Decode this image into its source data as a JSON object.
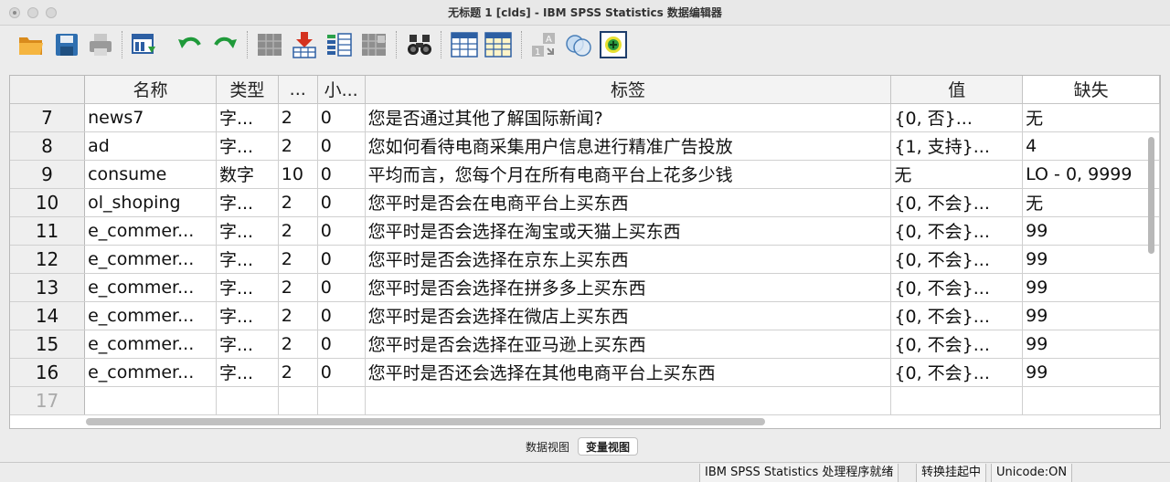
{
  "window": {
    "title": "无标题 1 [clds] - IBM SPSS Statistics 数据编辑器"
  },
  "toolbar": {
    "buttons": [
      {
        "icon": "open-folder-icon"
      },
      {
        "icon": "save-icon"
      },
      {
        "icon": "print-icon"
      },
      {
        "icon": "recall-dialog-icon"
      },
      {
        "icon": "undo-icon"
      },
      {
        "icon": "redo-icon"
      },
      {
        "icon": "goto-case-icon"
      },
      {
        "icon": "insert-case-icon"
      },
      {
        "icon": "insert-variable-icon"
      },
      {
        "icon": "split-file-icon"
      },
      {
        "icon": "find-icon"
      },
      {
        "icon": "data-view-grid-icon"
      },
      {
        "icon": "variable-view-grid-icon"
      },
      {
        "icon": "value-labels-icon"
      },
      {
        "icon": "use-sets-icon"
      },
      {
        "icon": "spelling-icon"
      }
    ]
  },
  "grid": {
    "columns": [
      "名称",
      "类型",
      "...",
      "小...",
      "标签",
      "值",
      "缺失"
    ],
    "rows": [
      {
        "n": "7",
        "name": "news7",
        "type": "字...",
        "width": "2",
        "dec": "0",
        "label": "您是否通过其他了解国际新闻?",
        "values": "{0, 否}...",
        "missing": "无"
      },
      {
        "n": "8",
        "name": "ad",
        "type": "字...",
        "width": "2",
        "dec": "0",
        "label": "您如何看待电商采集用户信息进行精准广告投放",
        "values": "{1, 支持}...",
        "missing": "4"
      },
      {
        "n": "9",
        "name": "consume",
        "type": "数字",
        "width": "10",
        "dec": "0",
        "label": "平均而言，您每个月在所有电商平台上花多少钱",
        "values": "无",
        "missing": "LO - 0, 9999"
      },
      {
        "n": "10",
        "name": "ol_shoping",
        "type": "字...",
        "width": "2",
        "dec": "0",
        "label": "您平时是否会在电商平台上买东西",
        "values": "{0, 不会}...",
        "missing": "无"
      },
      {
        "n": "11",
        "name": "e_commer...",
        "type": "字...",
        "width": "2",
        "dec": "0",
        "label": "您平时是否会选择在淘宝或天猫上买东西",
        "values": "{0, 不会}...",
        "missing": "99"
      },
      {
        "n": "12",
        "name": "e_commer...",
        "type": "字...",
        "width": "2",
        "dec": "0",
        "label": "您平时是否会选择在京东上买东西",
        "values": "{0, 不会}...",
        "missing": "99"
      },
      {
        "n": "13",
        "name": "e_commer...",
        "type": "字...",
        "width": "2",
        "dec": "0",
        "label": "您平时是否会选择在拼多多上买东西",
        "values": "{0, 不会}...",
        "missing": "99"
      },
      {
        "n": "14",
        "name": "e_commer...",
        "type": "字...",
        "width": "2",
        "dec": "0",
        "label": "您平时是否会选择在微店上买东西",
        "values": "{0, 不会}...",
        "missing": "99"
      },
      {
        "n": "15",
        "name": "e_commer...",
        "type": "字...",
        "width": "2",
        "dec": "0",
        "label": "您平时是否会选择在亚马逊上买东西",
        "values": "{0, 不会}...",
        "missing": "99"
      },
      {
        "n": "16",
        "name": "e_commer...",
        "type": "字...",
        "width": "2",
        "dec": "0",
        "label": "您平时是否还会选择在其他电商平台上买东西",
        "values": "{0, 不会}...",
        "missing": "99"
      },
      {
        "n": "17",
        "name": "",
        "type": "",
        "width": "",
        "dec": "",
        "label": "",
        "values": "",
        "missing": ""
      }
    ]
  },
  "tabs": [
    {
      "label": "数据视图",
      "active": false
    },
    {
      "label": "变量视图",
      "active": true
    }
  ],
  "status": {
    "processor": "IBM SPSS Statistics 处理程序就绪",
    "transform": "转换挂起中",
    "unicode": "Unicode:ON"
  }
}
